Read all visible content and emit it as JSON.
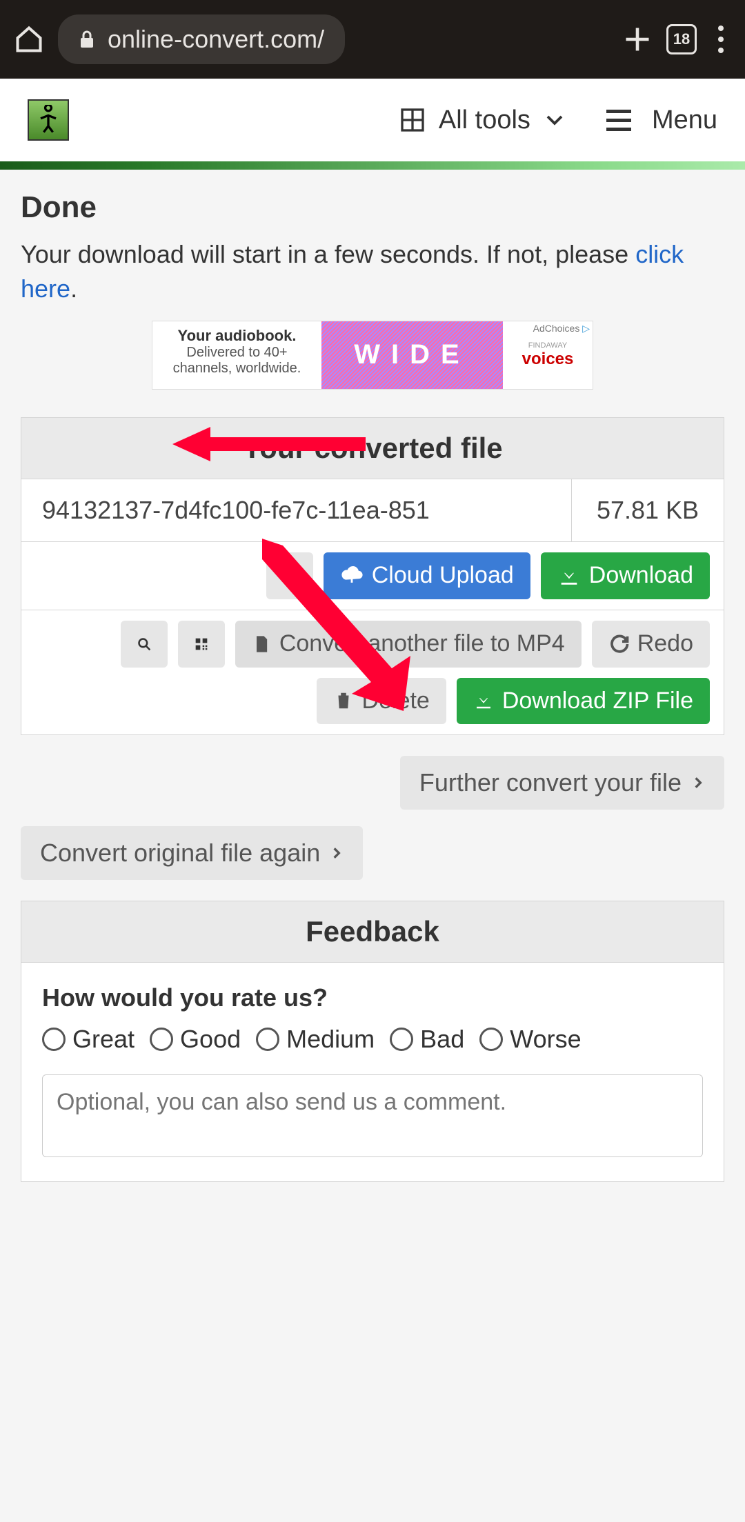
{
  "browser": {
    "url": "online-convert.com/",
    "tab_count": "18"
  },
  "header": {
    "all_tools": "All tools",
    "menu": "Menu"
  },
  "page": {
    "done": "Done",
    "msg_before": "Your download will start in a few seconds. If not, please ",
    "click_here": "click here",
    "msg_after": "."
  },
  "ad": {
    "line1": "Your audiobook.",
    "line2": "Delivered to 40+ channels, worldwide.",
    "center": "WIDE",
    "brand_small": "FINDAWAY",
    "brand": "voices",
    "choices": "AdChoices"
  },
  "converted": {
    "title": "Your converted file",
    "filename": "94132137-7d4fc100-fe7c-11ea-851",
    "filesize": "57.81 KB"
  },
  "buttons": {
    "cloud_upload": "Cloud Upload",
    "download": "Download",
    "convert_another": "Convert another file to MP4",
    "redo": "Redo",
    "delete": "Delete",
    "download_zip": "Download ZIP File",
    "further_convert": "Further convert your file",
    "convert_again": "Convert original file again"
  },
  "feedback": {
    "title": "Feedback",
    "question": "How would you rate us?",
    "options": [
      "Great",
      "Good",
      "Medium",
      "Bad",
      "Worse"
    ],
    "comment_placeholder": "Optional, you can also send us a comment."
  }
}
